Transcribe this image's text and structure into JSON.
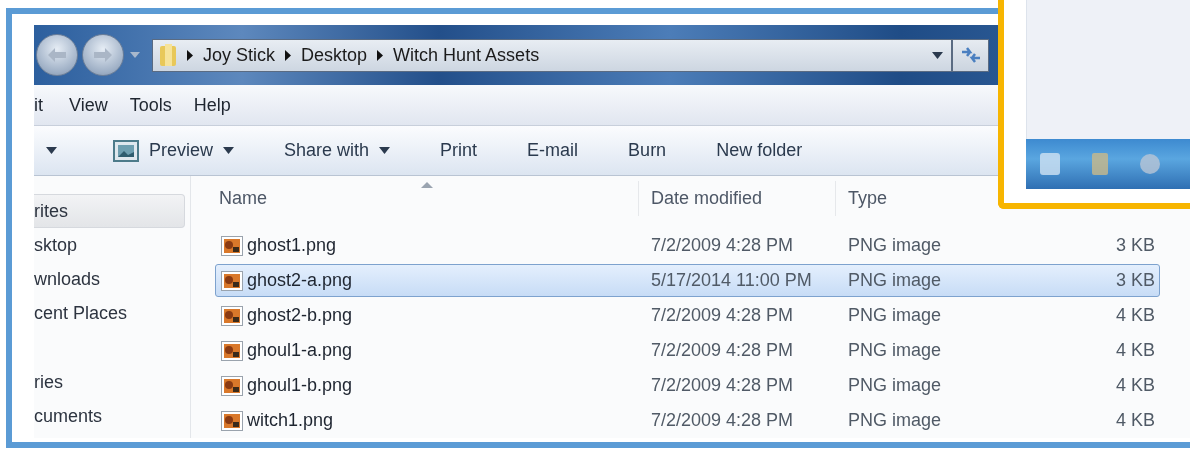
{
  "address_bar": {
    "path": [
      "Joy Stick",
      "Desktop",
      "Witch Hunt Assets"
    ]
  },
  "menu_bar": [
    "it",
    "View",
    "Tools",
    "Help"
  ],
  "toolbar": [
    {
      "kind": "arrow"
    },
    {
      "kind": "preview",
      "label": "Preview"
    },
    {
      "kind": "menu",
      "label": "Share with"
    },
    {
      "kind": "plain",
      "label": "Print"
    },
    {
      "kind": "plain",
      "label": "E-mail"
    },
    {
      "kind": "plain",
      "label": "Burn"
    },
    {
      "kind": "plain",
      "label": "New folder"
    }
  ],
  "nav_pane": {
    "groups": [
      {
        "items": [
          {
            "label": "rites",
            "selected": true
          },
          {
            "label": "sktop",
            "selected": false
          },
          {
            "label": "wnloads",
            "selected": false
          },
          {
            "label": "cent Places",
            "selected": false
          }
        ]
      },
      {
        "items": [
          {
            "label": "ries",
            "selected": false
          },
          {
            "label": "cuments",
            "selected": false
          }
        ]
      }
    ]
  },
  "file_list": {
    "columns": [
      {
        "label": "Name",
        "sorted": true
      },
      {
        "label": "Date modified",
        "sorted": false
      },
      {
        "label": "Type",
        "sorted": false
      }
    ],
    "rows": [
      {
        "name": "ghost1.png",
        "date": "7/2/2009 4:28 PM",
        "type": "PNG image",
        "size": "3 KB",
        "selected": false
      },
      {
        "name": "ghost2-a.png",
        "date": "5/17/2014 11:00 PM",
        "type": "PNG image",
        "size": "3 KB",
        "selected": true
      },
      {
        "name": "ghost2-b.png",
        "date": "7/2/2009 4:28 PM",
        "type": "PNG image",
        "size": "4 KB",
        "selected": false
      },
      {
        "name": "ghoul1-a.png",
        "date": "7/2/2009 4:28 PM",
        "type": "PNG image",
        "size": "4 KB",
        "selected": false
      },
      {
        "name": "ghoul1-b.png",
        "date": "7/2/2009 4:28 PM",
        "type": "PNG image",
        "size": "4 KB",
        "selected": false
      },
      {
        "name": "witch1.png",
        "date": "7/2/2009 4:28 PM",
        "type": "PNG image",
        "size": "4 KB",
        "selected": false
      }
    ]
  }
}
